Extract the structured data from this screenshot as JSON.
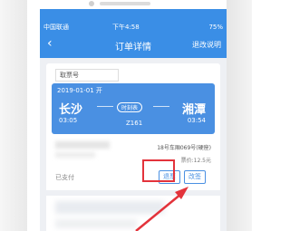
{
  "status_bar": {
    "carrier": "中国联通",
    "time": "下午4:58",
    "battery": "75%"
  },
  "nav": {
    "title": "订单详情",
    "right_link": "退改说明"
  },
  "ticket": {
    "ticket_label": "取票号",
    "date": "2019-01-01 开",
    "from_station": "长沙",
    "to_station": "湘潭",
    "depart_time": "03:05",
    "arrive_time": "03:54",
    "schedule_label": "时刻表",
    "train_no": "Z161",
    "seat_info": "18号车厢069号(硬座)",
    "price": "票价:12.5元",
    "pay_status": "已支付",
    "refund_label": "退票",
    "change_label": "改签"
  },
  "colors": {
    "accent": "#3a8ee6",
    "highlight": "#e3333b"
  }
}
